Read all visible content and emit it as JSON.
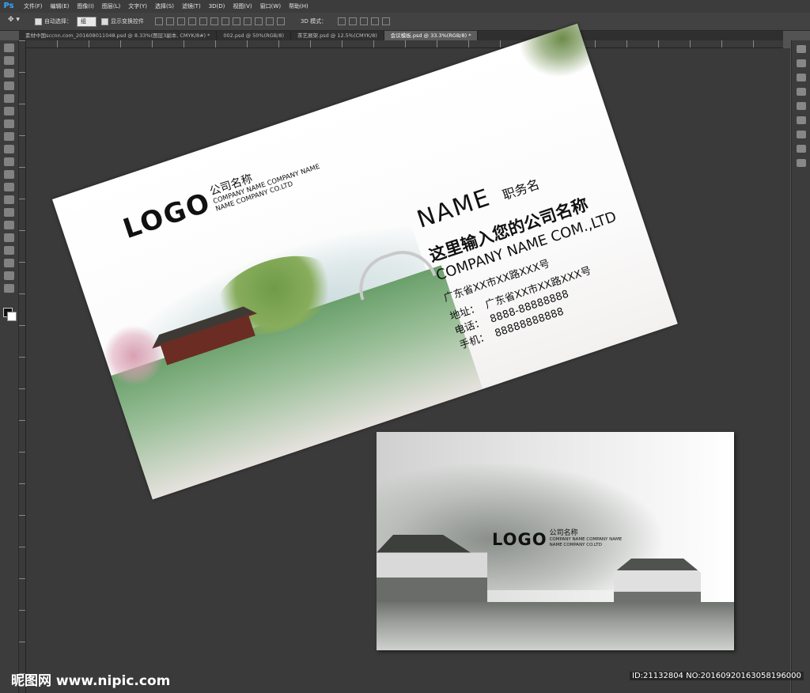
{
  "menubar": {
    "app_icon": "Ps",
    "items": [
      "文件(F)",
      "编辑(E)",
      "图像(I)",
      "图层(L)",
      "文字(Y)",
      "选择(S)",
      "滤镜(T)",
      "3D(D)",
      "视图(V)",
      "窗口(W)",
      "帮助(H)"
    ]
  },
  "optionsbar": {
    "auto_select_label": "自动选择：",
    "auto_select_value": "组",
    "show_transform_label": "显示变换控件",
    "mode_label": "3D 模式："
  },
  "tabs": [
    "素材中国sccnn.com_2016080110​48.psd @ 8.33%(图层3副本, CMYK/8#) *",
    "002.psd @ 50%(RGB/8)",
    "茶艺展架.psd @ 12.5%(CMYK/8)",
    "会议模板.psd @ 33.3%(RGB/8) *"
  ],
  "front_card": {
    "logo": "LOGO",
    "company_name": "公司名称",
    "company_en_1": "COMPANY NAME COMPANY NAME",
    "company_en_2": "NAME COMPANY CO.LTD",
    "name": "NAME",
    "job_title": "职务名",
    "company_cn": "这里输入您的公司名称",
    "company_en": "COMPANY NAME COM.,LTD",
    "address": "广东省XX市XX路XXX号",
    "contacts": [
      {
        "label": "地址：",
        "value": "广东省XX市XX路XXX号"
      },
      {
        "label": "电话：",
        "value": "8888-88888888"
      },
      {
        "label": "手机：",
        "value": "88888888888"
      }
    ]
  },
  "back_card": {
    "logo": "LOGO",
    "company_name": "公司名称",
    "company_en_1": "COMPANY NAME COMPANY NAME",
    "company_en_2": "NAME COMPANY CO.LTD"
  },
  "watermark": "昵图网 www.nipic.com",
  "image_id": "ID:21132804 NO:20160920163058196000",
  "icons": [
    "move-tool-icon",
    "marquee-tool-icon",
    "lasso-tool-icon",
    "crop-tool-icon",
    "brush-tool-icon",
    "text-tool-icon",
    "hand-tool-icon",
    "zoom-tool-icon"
  ]
}
